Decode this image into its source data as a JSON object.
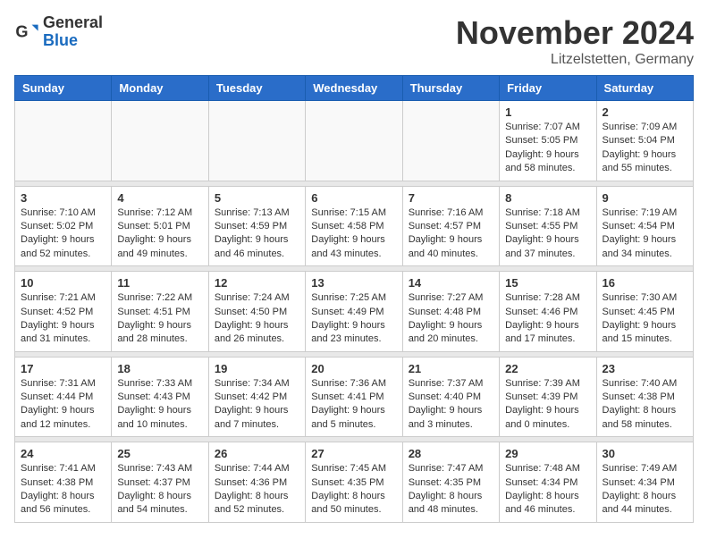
{
  "header": {
    "logo_general": "General",
    "logo_blue": "Blue",
    "month_title": "November 2024",
    "location": "Litzelstetten, Germany"
  },
  "weekdays": [
    "Sunday",
    "Monday",
    "Tuesday",
    "Wednesday",
    "Thursday",
    "Friday",
    "Saturday"
  ],
  "weeks": [
    [
      {
        "day": "",
        "info": ""
      },
      {
        "day": "",
        "info": ""
      },
      {
        "day": "",
        "info": ""
      },
      {
        "day": "",
        "info": ""
      },
      {
        "day": "",
        "info": ""
      },
      {
        "day": "1",
        "info": "Sunrise: 7:07 AM\nSunset: 5:05 PM\nDaylight: 9 hours and 58 minutes."
      },
      {
        "day": "2",
        "info": "Sunrise: 7:09 AM\nSunset: 5:04 PM\nDaylight: 9 hours and 55 minutes."
      }
    ],
    [
      {
        "day": "3",
        "info": "Sunrise: 7:10 AM\nSunset: 5:02 PM\nDaylight: 9 hours and 52 minutes."
      },
      {
        "day": "4",
        "info": "Sunrise: 7:12 AM\nSunset: 5:01 PM\nDaylight: 9 hours and 49 minutes."
      },
      {
        "day": "5",
        "info": "Sunrise: 7:13 AM\nSunset: 4:59 PM\nDaylight: 9 hours and 46 minutes."
      },
      {
        "day": "6",
        "info": "Sunrise: 7:15 AM\nSunset: 4:58 PM\nDaylight: 9 hours and 43 minutes."
      },
      {
        "day": "7",
        "info": "Sunrise: 7:16 AM\nSunset: 4:57 PM\nDaylight: 9 hours and 40 minutes."
      },
      {
        "day": "8",
        "info": "Sunrise: 7:18 AM\nSunset: 4:55 PM\nDaylight: 9 hours and 37 minutes."
      },
      {
        "day": "9",
        "info": "Sunrise: 7:19 AM\nSunset: 4:54 PM\nDaylight: 9 hours and 34 minutes."
      }
    ],
    [
      {
        "day": "10",
        "info": "Sunrise: 7:21 AM\nSunset: 4:52 PM\nDaylight: 9 hours and 31 minutes."
      },
      {
        "day": "11",
        "info": "Sunrise: 7:22 AM\nSunset: 4:51 PM\nDaylight: 9 hours and 28 minutes."
      },
      {
        "day": "12",
        "info": "Sunrise: 7:24 AM\nSunset: 4:50 PM\nDaylight: 9 hours and 26 minutes."
      },
      {
        "day": "13",
        "info": "Sunrise: 7:25 AM\nSunset: 4:49 PM\nDaylight: 9 hours and 23 minutes."
      },
      {
        "day": "14",
        "info": "Sunrise: 7:27 AM\nSunset: 4:48 PM\nDaylight: 9 hours and 20 minutes."
      },
      {
        "day": "15",
        "info": "Sunrise: 7:28 AM\nSunset: 4:46 PM\nDaylight: 9 hours and 17 minutes."
      },
      {
        "day": "16",
        "info": "Sunrise: 7:30 AM\nSunset: 4:45 PM\nDaylight: 9 hours and 15 minutes."
      }
    ],
    [
      {
        "day": "17",
        "info": "Sunrise: 7:31 AM\nSunset: 4:44 PM\nDaylight: 9 hours and 12 minutes."
      },
      {
        "day": "18",
        "info": "Sunrise: 7:33 AM\nSunset: 4:43 PM\nDaylight: 9 hours and 10 minutes."
      },
      {
        "day": "19",
        "info": "Sunrise: 7:34 AM\nSunset: 4:42 PM\nDaylight: 9 hours and 7 minutes."
      },
      {
        "day": "20",
        "info": "Sunrise: 7:36 AM\nSunset: 4:41 PM\nDaylight: 9 hours and 5 minutes."
      },
      {
        "day": "21",
        "info": "Sunrise: 7:37 AM\nSunset: 4:40 PM\nDaylight: 9 hours and 3 minutes."
      },
      {
        "day": "22",
        "info": "Sunrise: 7:39 AM\nSunset: 4:39 PM\nDaylight: 9 hours and 0 minutes."
      },
      {
        "day": "23",
        "info": "Sunrise: 7:40 AM\nSunset: 4:38 PM\nDaylight: 8 hours and 58 minutes."
      }
    ],
    [
      {
        "day": "24",
        "info": "Sunrise: 7:41 AM\nSunset: 4:38 PM\nDaylight: 8 hours and 56 minutes."
      },
      {
        "day": "25",
        "info": "Sunrise: 7:43 AM\nSunset: 4:37 PM\nDaylight: 8 hours and 54 minutes."
      },
      {
        "day": "26",
        "info": "Sunrise: 7:44 AM\nSunset: 4:36 PM\nDaylight: 8 hours and 52 minutes."
      },
      {
        "day": "27",
        "info": "Sunrise: 7:45 AM\nSunset: 4:35 PM\nDaylight: 8 hours and 50 minutes."
      },
      {
        "day": "28",
        "info": "Sunrise: 7:47 AM\nSunset: 4:35 PM\nDaylight: 8 hours and 48 minutes."
      },
      {
        "day": "29",
        "info": "Sunrise: 7:48 AM\nSunset: 4:34 PM\nDaylight: 8 hours and 46 minutes."
      },
      {
        "day": "30",
        "info": "Sunrise: 7:49 AM\nSunset: 4:34 PM\nDaylight: 8 hours and 44 minutes."
      }
    ]
  ]
}
